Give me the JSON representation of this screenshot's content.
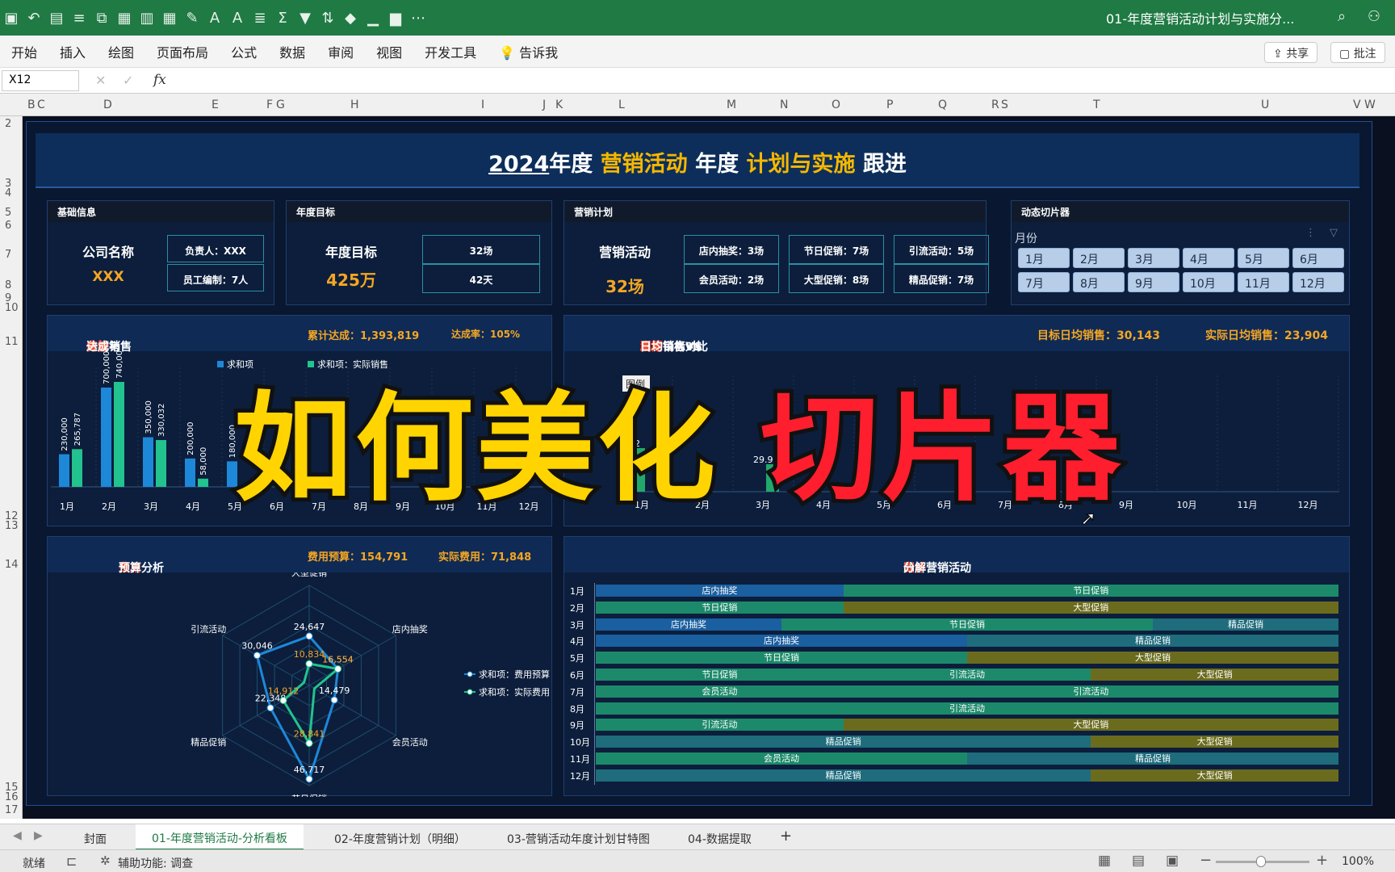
{
  "app": {
    "doc_title": "01-年度营销活动计划与实施分...",
    "share": "共享",
    "comment": "批注"
  },
  "menu": [
    "开始",
    "插入",
    "绘图",
    "页面布局",
    "公式",
    "数据",
    "审阅",
    "视图",
    "开发工具",
    "告诉我"
  ],
  "formula": {
    "cell_ref": "X12",
    "fx": "fx"
  },
  "columns": [
    "B",
    "C",
    "D",
    "E",
    "F",
    "G",
    "H",
    "I",
    "J",
    "K",
    "L",
    "M",
    "N",
    "O",
    "P",
    "Q",
    "R",
    "S",
    "T",
    "U",
    "V",
    "W"
  ],
  "rows": [
    "2",
    "3",
    "4",
    "5",
    "6",
    "7",
    "8",
    "9",
    "10",
    "11",
    "12",
    "13",
    "14",
    "15",
    "16",
    "17"
  ],
  "dashboard": {
    "title_year": "2024",
    "title_a": "年度 ",
    "title_b": "营销活动",
    "title_c": " 年度 ",
    "title_d": "计划与实施",
    "title_e": " 跟进",
    "basic": {
      "head": "基础信息",
      "company_label": "公司名称",
      "company_value": "XXX",
      "owner": "负责人：XXX",
      "staff": "员工编制：7人"
    },
    "target": {
      "head": "年度目标",
      "label": "年度目标",
      "value": "425万",
      "box1": "32场",
      "box2": "42天"
    },
    "plan": {
      "head": "营销计划",
      "label": "营销活动",
      "value": "32场",
      "boxes": [
        "店内抽奖：3场",
        "节日促销：7场",
        "引流活动：5场",
        "会员活动：2场",
        "大型促销：8场",
        "精品促销：7场"
      ]
    },
    "slicer": {
      "head": "动态切片器",
      "field": "月份",
      "months": [
        "1月",
        "2月",
        "3月",
        "4月",
        "5月",
        "6月",
        "7月",
        "8月",
        "9月",
        "10月",
        "11月",
        "12月"
      ]
    },
    "sales": {
      "title_a": "一、销售",
      "title_b": "目标",
      "title_c": "分解与",
      "title_d": "实际",
      "title_e": "达成",
      "cum": "累计达成：1,393,819",
      "rate": "达成率：105%",
      "legend_b": "求和项：实际销售",
      "legend_a": "求和项"
    },
    "daily": {
      "title_a": "二、",
      "title_b": "同期",
      "title_c": "日均销售VS",
      "title_d": "活动",
      "title_e": "日均目标vs",
      "title_f": "实际",
      "title_g": "日均销售对比",
      "target": "目标日均销售：30,143",
      "actual": "实际日均销售：23,904",
      "legend_frag": "图例"
    },
    "cost": {
      "title_a": "三、",
      "title_b": "费用",
      "title_c": "预算分析",
      "budget": "费用预算：154,791",
      "actual": "实际费用：71,848",
      "legend1": "求和项：费用预算",
      "legend2": "求和项：实际费用"
    },
    "schedule": {
      "title_a": "四、营销活动",
      "title_b": "安排",
      "title_c": "分解"
    }
  },
  "chart_data": [
    {
      "type": "bar",
      "title": "一、销售目标分解与实际达成",
      "categories": [
        "1月",
        "2月",
        "3月",
        "4月",
        "5月",
        "6月",
        "7月",
        "8月",
        "9月",
        "10月",
        "11月",
        "12月"
      ],
      "series": [
        {
          "name": "求和项",
          "values": [
            230000,
            700000,
            350000,
            200000,
            180000,
            null,
            null,
            null,
            null,
            null,
            null,
            null
          ]
        },
        {
          "name": "求和项：实际销售",
          "values": [
            265787,
            740000,
            330032,
            58000,
            null,
            null,
            null,
            null,
            null,
            null,
            null,
            null
          ]
        }
      ],
      "data_labels": [
        "230,000",
        "265,787",
        "700,000",
        "740,000",
        "350,000",
        "330,032",
        "200,000",
        "58,000",
        "180,000"
      ]
    },
    {
      "type": "line",
      "title": "二、同期日均销售VS活动日均目标vs实际日均销售对比",
      "categories": [
        "1月",
        "2月",
        "3月",
        "4月",
        "5月",
        "6月",
        "7月",
        "8月",
        "9月",
        "10月",
        "11月",
        "12月"
      ],
      "visible_labels": [
        "32",
        "29.9"
      ]
    },
    {
      "type": "radar",
      "title": "三、费用预算分析",
      "categories": [
        "大型促销",
        "店内抽奖",
        "会员活动",
        "节日促销",
        "精品促销",
        "引流活动"
      ],
      "series": [
        {
          "name": "求和项：费用预算",
          "values": [
            24647,
            16554,
            14479,
            46717,
            22348,
            30046
          ]
        },
        {
          "name": "求和项：实际费用",
          "values": [
            10834,
            16554,
            null,
            28841,
            14912,
            null
          ]
        }
      ],
      "data_labels": [
        "24,647",
        "10,834",
        "16,554",
        "14,479",
        "46,717",
        "28,841",
        "22,348",
        "14,912",
        "30,046"
      ]
    },
    {
      "type": "gantt",
      "title": "四、营销活动安排分解",
      "months": [
        "1月",
        "2月",
        "3月",
        "4月",
        "5月",
        "6月",
        "7月",
        "8月",
        "9月",
        "10月",
        "11月",
        "12月"
      ],
      "rows": [
        [
          {
            "label": "店内抽奖",
            "span": 2,
            "color": "#1a5fa0"
          },
          {
            "label": "节日促销",
            "span": 4,
            "color": "#1c8a6a"
          }
        ],
        [
          {
            "label": "节日促销",
            "span": 2,
            "color": "#1c8a6a"
          },
          {
            "label": "大型促销",
            "span": 4,
            "color": "#6b6b1e"
          }
        ],
        [
          {
            "label": "店内抽奖",
            "span": 1.5,
            "color": "#1a5fa0"
          },
          {
            "label": "节日促销",
            "span": 3,
            "color": "#1c8a6a"
          },
          {
            "label": "精品促销",
            "span": 1.5,
            "color": "#1e6c7c"
          }
        ],
        [
          {
            "label": "店内抽奖",
            "span": 3,
            "color": "#1a5fa0"
          },
          {
            "label": "精品促销",
            "span": 3,
            "color": "#1e6c7c"
          }
        ],
        [
          {
            "label": "节日促销",
            "span": 3,
            "color": "#1c8a6a"
          },
          {
            "label": "大型促销",
            "span": 3,
            "color": "#6b6b1e"
          }
        ],
        [
          {
            "label": "节日促销",
            "span": 2,
            "color": "#1c8a6a"
          },
          {
            "label": "引流活动",
            "span": 2,
            "color": "#1c8a6a"
          },
          {
            "label": "大型促销",
            "span": 2,
            "color": "#6b6b1e"
          }
        ],
        [
          {
            "label": "会员活动",
            "span": 2,
            "color": "#1c8a6a"
          },
          {
            "label": "引流活动",
            "span": 4,
            "color": "#1c8a6a"
          }
        ],
        [
          {
            "label": "引流活动",
            "span": 6,
            "color": "#1c8a6a"
          }
        ],
        [
          {
            "label": "引流活动",
            "span": 2,
            "color": "#1c8a6a"
          },
          {
            "label": "大型促销",
            "span": 4,
            "color": "#6b6b1e"
          }
        ],
        [
          {
            "label": "精品促销",
            "span": 4,
            "color": "#1e6c7c"
          },
          {
            "label": "大型促销",
            "span": 2,
            "color": "#6b6b1e"
          }
        ],
        [
          {
            "label": "会员活动",
            "span": 3,
            "color": "#1c8a6a"
          },
          {
            "label": "精品促销",
            "span": 3,
            "color": "#1e6c7c"
          }
        ],
        [
          {
            "label": "精品促销",
            "span": 4,
            "color": "#1e6c7c"
          },
          {
            "label": "大型促销",
            "span": 2,
            "color": "#6b6b1e"
          }
        ]
      ]
    }
  ],
  "overlay": {
    "part1": "如何美化",
    "part2": "切片器"
  },
  "tabs": [
    "封面",
    "01-年度营销活动-分析看板",
    "02-年度营销计划（明细）",
    "03-营销活动年度计划甘特图",
    "04-数据提取",
    "+"
  ],
  "status": {
    "ready": "就绪",
    "access": "辅助功能: 调查",
    "zoom": "100%"
  },
  "colors": {
    "ribbon": "#1f7a44",
    "accent": "#f5a623",
    "dash_bg": "#0a1730",
    "series_blue": "#1e88d8",
    "series_green": "#22c38e"
  }
}
